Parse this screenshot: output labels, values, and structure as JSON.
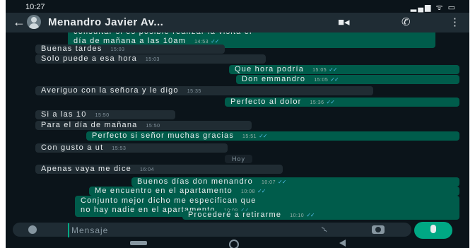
{
  "status": {
    "time": "10:27",
    "icons": "▂▄▆ ᯤ ▭"
  },
  "header": {
    "back_icon": "←",
    "contact_name": "Menandro Javier Av...",
    "video_icon": "■◂",
    "call_icon": "✆",
    "menu_icon": "⋮"
  },
  "messages": [
    {
      "dir": "out",
      "lines": [
        "consultar si es posible realizar la visita el",
        "día de mañana a las 10am"
      ],
      "time": "14:53",
      "ticks": "✓✓"
    },
    {
      "dir": "in",
      "text": "Buenas tardes",
      "time": "15:03"
    },
    {
      "dir": "in",
      "text": "Solo puede a esa hora",
      "time": "15:03"
    },
    {
      "dir": "out",
      "text": "Que hora podría",
      "time": "15:05",
      "ticks": "✓✓"
    },
    {
      "dir": "out",
      "text": "Don emmandro",
      "time": "15:05",
      "ticks": "✓✓"
    },
    {
      "dir": "in",
      "text": "Averiguo con la señora y le digo",
      "time": "15:35"
    },
    {
      "dir": "out",
      "text": "Perfecto al dolor",
      "time": "15:36",
      "ticks": "✓✓"
    },
    {
      "dir": "in",
      "text": "Si a las 10",
      "time": "15:50"
    },
    {
      "dir": "in",
      "text": "Para el día de mañana",
      "time": "15:50"
    },
    {
      "dir": "out",
      "text": "Perfecto si señor muchas gracias",
      "time": "15:51",
      "ticks": "✓✓"
    },
    {
      "dir": "in",
      "text": "Con gusto a ut",
      "time": "15:53"
    },
    {
      "dir": "in",
      "text": "Apenas vaya me dice",
      "time": "16:04"
    },
    {
      "dir": "out",
      "text": "Buenos días don menandro",
      "time": "10:07",
      "ticks": "✓✓"
    },
    {
      "dir": "out",
      "text": "Me encuentro en el apartamento",
      "time": "10:08",
      "ticks": "✓✓"
    },
    {
      "dir": "out",
      "lines": [
        "Conjunto mejor dicho me especifican que",
        "no hay nadie en el apartamento"
      ],
      "time": "10:09",
      "ticks": "✓✓"
    },
    {
      "dir": "out",
      "text": "Procederé a retirarme",
      "time": "10:10",
      "ticks": "✓✓"
    }
  ],
  "day_chip": "Hoy",
  "input": {
    "placeholder": "Mensaje"
  },
  "colors": {
    "background": "#0b141a",
    "outgoing": "#005c4b",
    "incoming": "#202c33",
    "accent": "#00a884"
  }
}
